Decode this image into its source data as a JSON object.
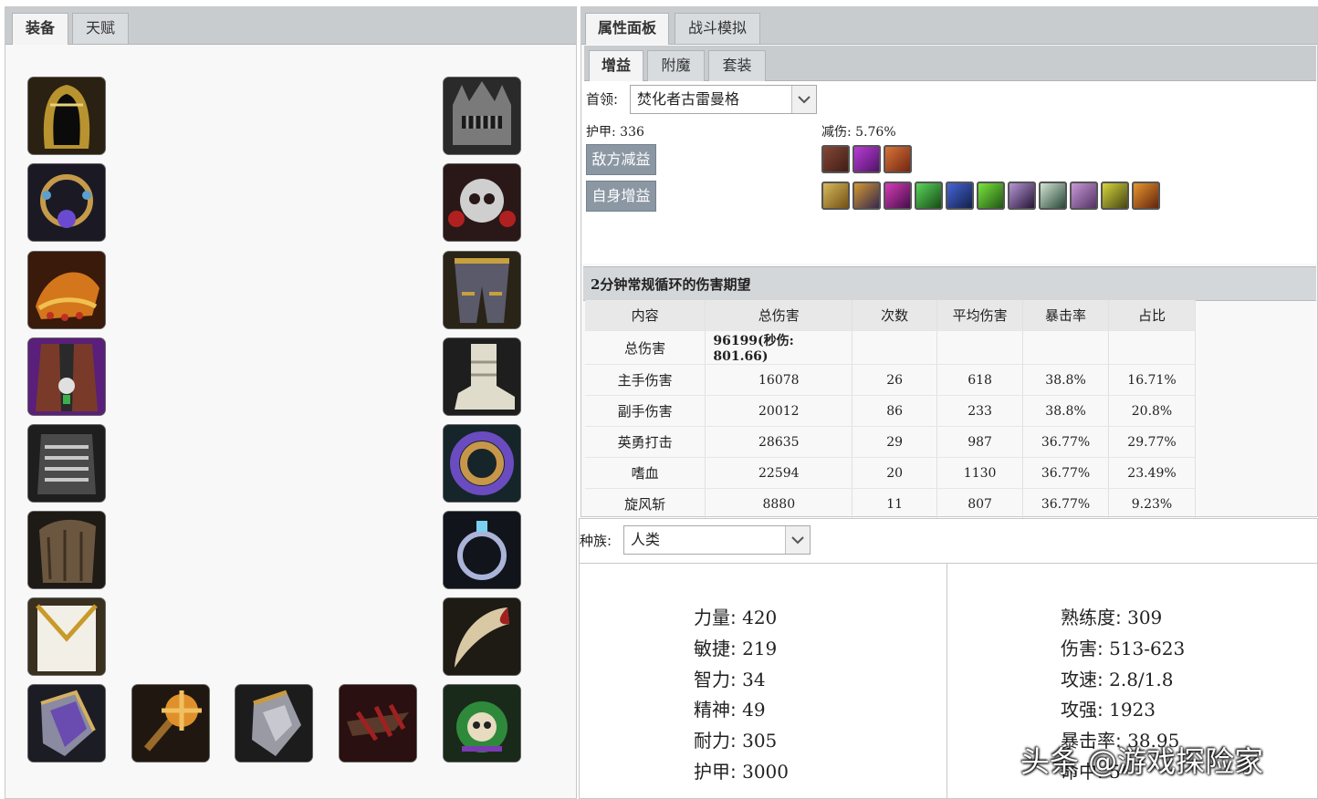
{
  "left_tabs": [
    "装备",
    "天赋"
  ],
  "right_tabs": [
    "属性面板",
    "战斗模拟"
  ],
  "sub_tabs": [
    "增益",
    "附魔",
    "套装"
  ],
  "boss": {
    "label": "首领:",
    "value": "焚化者古雷曼格"
  },
  "armor_label": "护甲: 336",
  "reduction_label": "减伤: 5.76%",
  "enemy_debuff_button": "敌方减益",
  "self_buff_button": "自身增益",
  "equipment_left": [
    "hood-helm-icon",
    "amulet-necklace-icon",
    "shoulder-pauldron-icon",
    "purple-cloak-icon",
    "chest-armor-icon",
    "wrist-bracer-icon",
    "white-tabard-icon",
    "gauntlet-icon"
  ],
  "equipment_right": [
    "spiked-helm-icon",
    "skull-shoulder-icon",
    "leg-armor-icon",
    "boot-icon",
    "purple-ring-icon",
    "silver-ring-icon",
    "fang-trinket-icon",
    "skull-trinket-icon"
  ],
  "equipment_bottom": [
    "orange-mace-icon",
    "steel-gauntlet-icon",
    "crimson-claw-icon"
  ],
  "debuff_icons": [
    "sunder-armor-icon",
    "curse-icon",
    "demoralize-icon"
  ],
  "buff_icons": [
    "fist-buff-icon",
    "helm-buff-icon",
    "paw-buff-icon",
    "green-leaf-icon",
    "bomb-icon",
    "green-potion-icon",
    "shadow-blade-icon",
    "arrow-buff-icon",
    "purple-slash-icon",
    "sword-buff-icon",
    "bull-icon"
  ],
  "table": {
    "title": "2分钟常规循环的伤害期望",
    "columns": [
      "内容",
      "总伤害",
      "次数",
      "平均伤害",
      "暴击率",
      "占比"
    ],
    "total_row": {
      "name": "总伤害",
      "value": "96199(秒伤: 801.66)"
    },
    "rows": [
      [
        "主手伤害",
        "16078",
        "26",
        "618",
        "38.8%",
        "16.71%"
      ],
      [
        "副手伤害",
        "20012",
        "86",
        "233",
        "38.8%",
        "20.8%"
      ],
      [
        "英勇打击",
        "28635",
        "29",
        "987",
        "36.77%",
        "29.77%"
      ],
      [
        "嗜血",
        "22594",
        "20",
        "1130",
        "36.77%",
        "23.49%"
      ],
      [
        "旋风斩",
        "8880",
        "11",
        "807",
        "36.77%",
        "9.23%"
      ]
    ]
  },
  "race": {
    "label": "种族:",
    "value": "人类"
  },
  "stats_left": [
    {
      "k": "力量:",
      "v": "420"
    },
    {
      "k": "敏捷:",
      "v": "219"
    },
    {
      "k": "智力:",
      "v": "34"
    },
    {
      "k": "精神:",
      "v": "49"
    },
    {
      "k": "耐力:",
      "v": "305"
    },
    {
      "k": "护甲:",
      "v": "3000"
    }
  ],
  "stats_right": [
    {
      "k": "熟练度:",
      "v": "309"
    },
    {
      "k": "伤害:",
      "v": "513-623"
    },
    {
      "k": "攻速:",
      "v": "2.8/1.8"
    },
    {
      "k": "攻强:",
      "v": "1923"
    },
    {
      "k": "暴击率:",
      "v": "38.95"
    },
    {
      "k": "命中:",
      "v": "5"
    }
  ],
  "watermark": "头条 @游戏探险家"
}
